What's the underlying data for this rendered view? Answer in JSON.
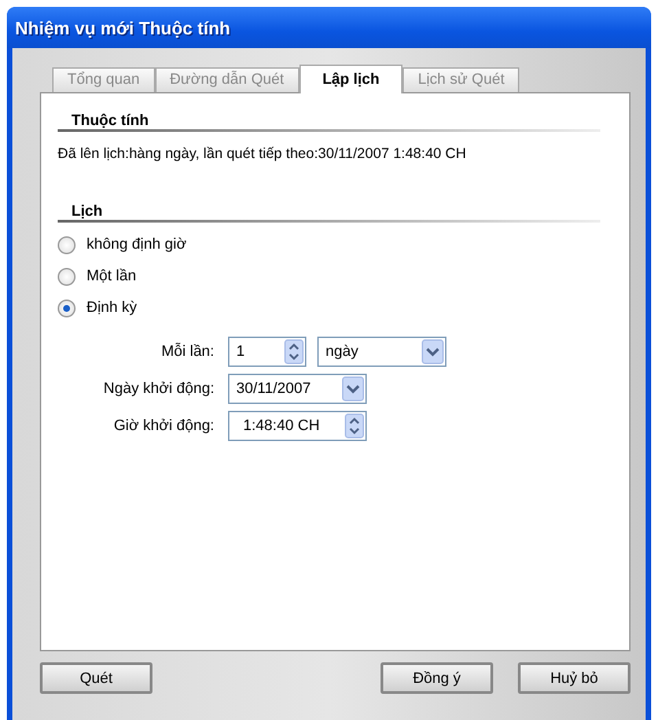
{
  "window": {
    "title": "Nhiệm vụ mới Thuộc tính"
  },
  "tabs": [
    {
      "label": "Tổng quan",
      "selected": false
    },
    {
      "label": "Đường dẫn Quét",
      "selected": false
    },
    {
      "label": "Lập lịch",
      "selected": true
    },
    {
      "label": "Lịch sử Quét",
      "selected": false
    }
  ],
  "properties": {
    "heading": "Thuộc tính",
    "summary": "Đã lên lịch:hàng ngày, lần quét tiếp theo:30/11/2007 1:48:40 CH"
  },
  "schedule": {
    "heading": "Lịch",
    "options": [
      {
        "label": "không định giờ",
        "selected": false
      },
      {
        "label": "Một lần",
        "selected": false
      },
      {
        "label": "Định kỳ",
        "selected": true
      }
    ],
    "every": {
      "label": "Mỗi lần:",
      "value": "1",
      "unit": "ngày"
    },
    "start_date": {
      "label": "Ngày khởi động:",
      "value": "30/11/2007"
    },
    "start_time": {
      "label": "Giờ khởi động:",
      "value": "1:48:40 CH"
    }
  },
  "buttons": [
    {
      "label": "Quét"
    },
    {
      "label": "Đồng ý"
    },
    {
      "label": "Huỷ bỏ"
    }
  ]
}
